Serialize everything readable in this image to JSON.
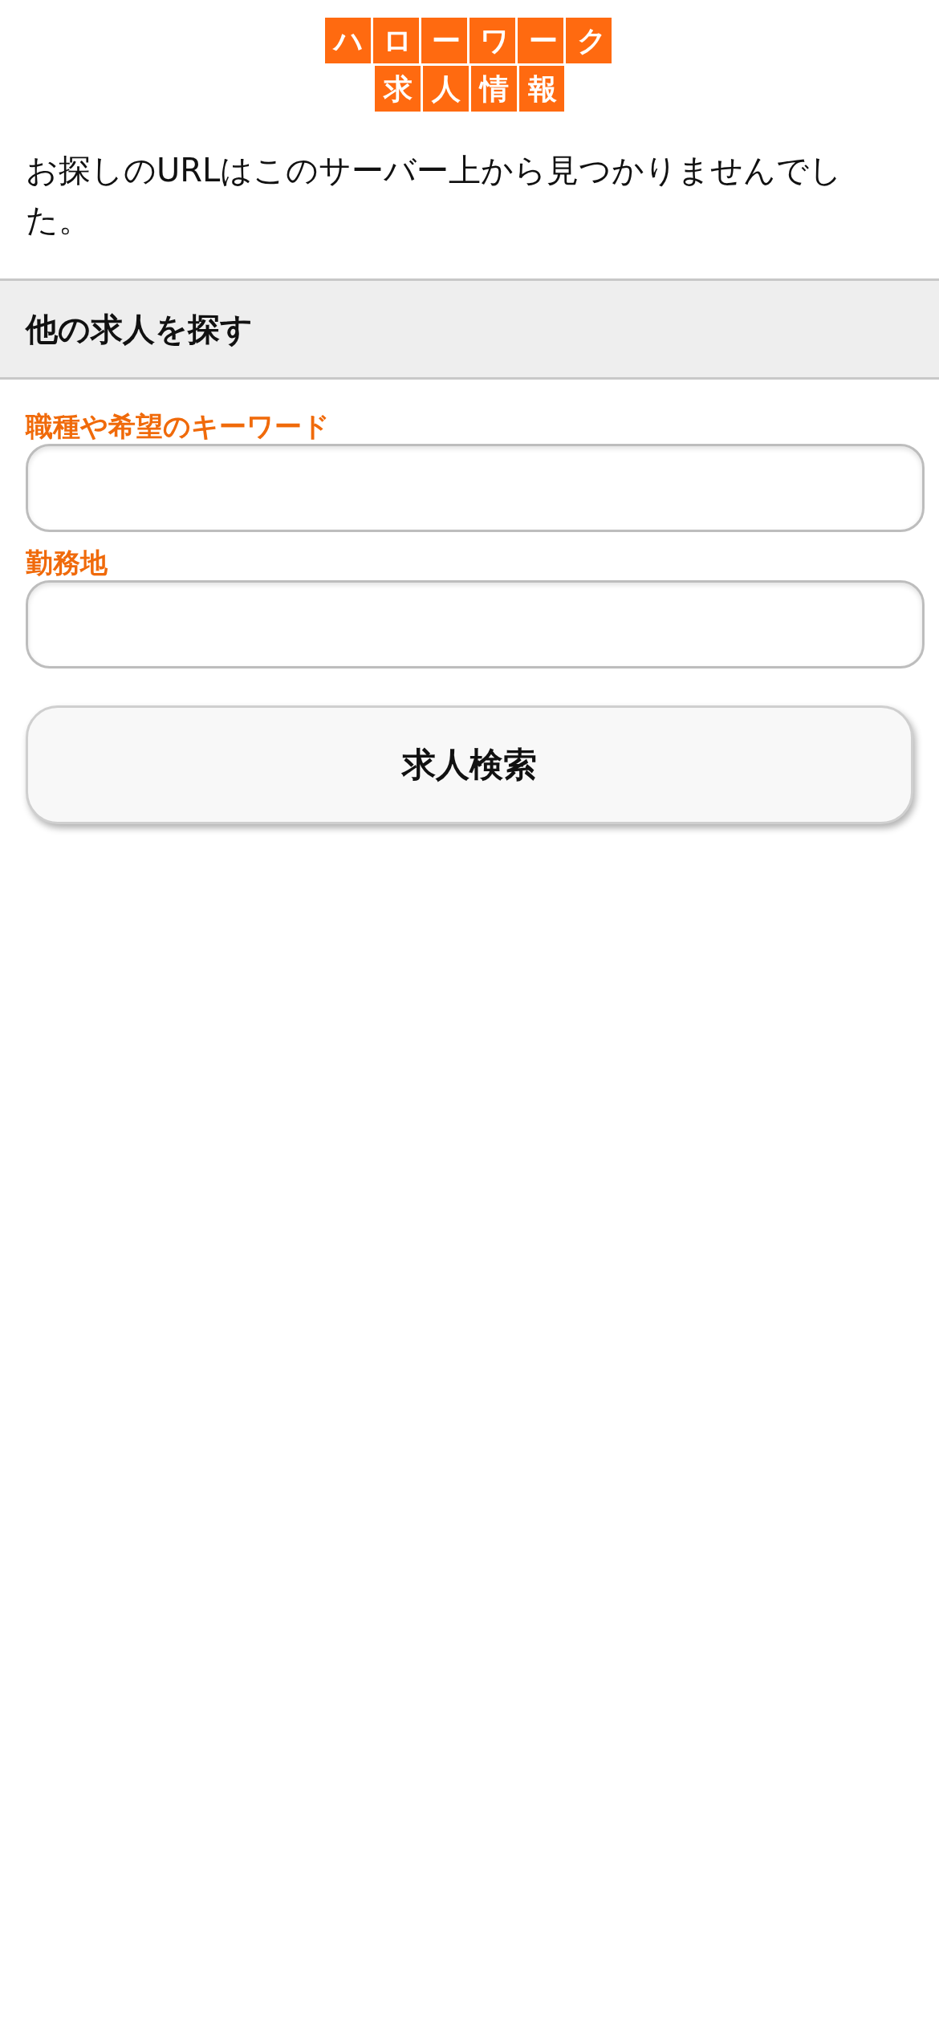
{
  "logo": {
    "lines": [
      "ハローワーク",
      "求人情報"
    ]
  },
  "message": "お探しのURLはこのサーバー上から見つかりませんでした。",
  "section": {
    "title": "他の求人を探す"
  },
  "fields": [
    {
      "label": "職種や希望のキーワード"
    },
    {
      "label": "勤務地"
    }
  ],
  "button": "求人検索"
}
